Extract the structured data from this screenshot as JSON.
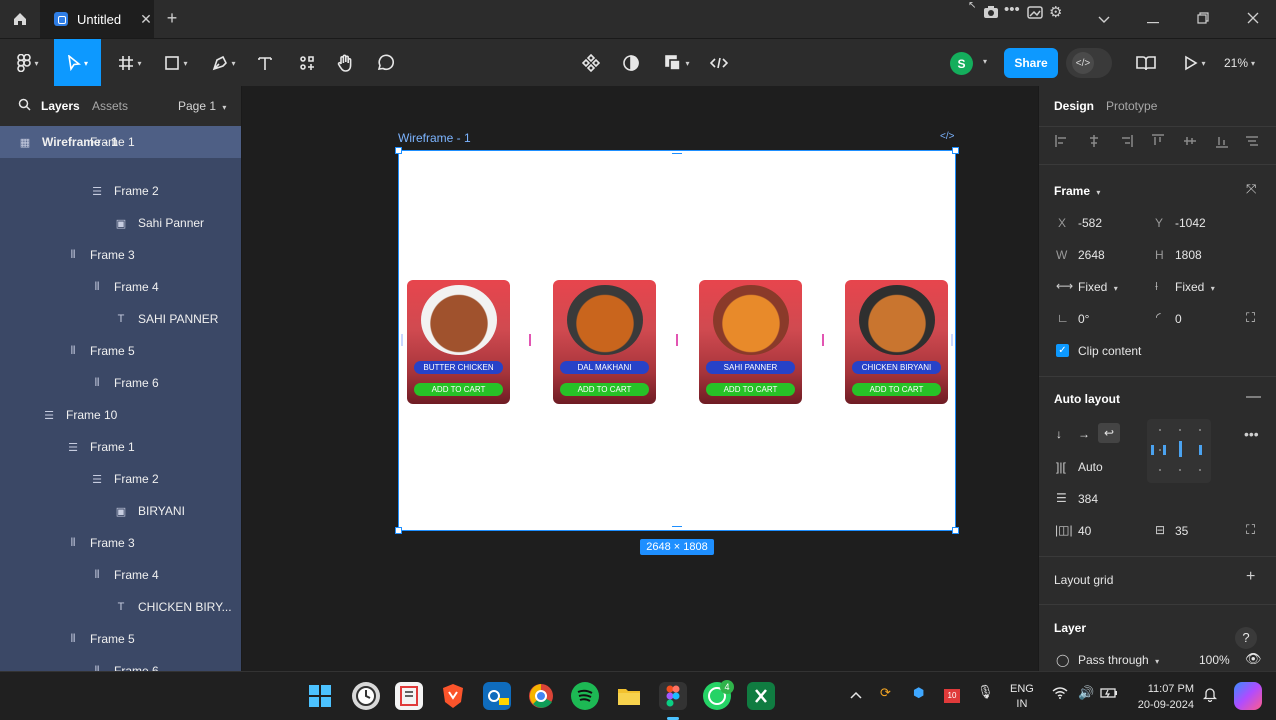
{
  "titlebar": {
    "file_tab": "Untitled",
    "new_tab": "+"
  },
  "toolbar": {
    "avatar_initial": "S",
    "share": "Share",
    "zoom": "21%"
  },
  "left_panel": {
    "tabs": [
      "Layers",
      "Assets"
    ],
    "page": "Page 1",
    "layers": [
      {
        "label": "Wireframe - 1",
        "indent": 0,
        "icon": "grid",
        "top": true
      },
      {
        "label": "Frame 1",
        "indent": 2,
        "icon": "rows"
      },
      {
        "label": "Frame 2",
        "indent": 3,
        "icon": "rows"
      },
      {
        "label": "Sahi Panner",
        "indent": 4,
        "icon": "image"
      },
      {
        "label": "Frame 3",
        "indent": 2,
        "icon": "cols"
      },
      {
        "label": "Frame 4",
        "indent": 3,
        "icon": "cols"
      },
      {
        "label": "SAHI PANNER",
        "indent": 4,
        "icon": "text"
      },
      {
        "label": "Frame 5",
        "indent": 2,
        "icon": "cols"
      },
      {
        "label": "Frame 6",
        "indent": 3,
        "icon": "cols"
      },
      {
        "label": "Frame 10",
        "indent": 1,
        "icon": "rows"
      },
      {
        "label": "Frame 1",
        "indent": 2,
        "icon": "rows"
      },
      {
        "label": "Frame 2",
        "indent": 3,
        "icon": "rows"
      },
      {
        "label": "BIRYANI",
        "indent": 4,
        "icon": "image"
      },
      {
        "label": "Frame 3",
        "indent": 2,
        "icon": "cols"
      },
      {
        "label": "Frame 4",
        "indent": 3,
        "icon": "cols"
      },
      {
        "label": "CHICKEN BIRY...",
        "indent": 4,
        "icon": "text"
      },
      {
        "label": "Frame 5",
        "indent": 2,
        "icon": "cols"
      },
      {
        "label": "Frame 6",
        "indent": 3,
        "icon": "cols"
      }
    ]
  },
  "canvas": {
    "frame_label": "Wireframe - 1",
    "frame_code": "</>",
    "size_badge": "2648 × 1808",
    "cards": [
      {
        "name": "BUTTER CHICKEN",
        "cart": "ADD TO CART",
        "food_color": "#a0522d",
        "plate_color": "#f2f2f2"
      },
      {
        "name": "DAL MAKHANI",
        "cart": "ADD TO CART",
        "food_color": "#c9651d",
        "plate_color": "#3a3a3a"
      },
      {
        "name": "SAHI PANNER",
        "cart": "ADD TO CART",
        "food_color": "#e88a2a",
        "plate_color": "#8a3a2a"
      },
      {
        "name": "CHICKEN BIRYANI",
        "cart": "ADD TO CART",
        "food_color": "#c9752f",
        "plate_color": "#2f2f2f"
      }
    ]
  },
  "right_panel": {
    "tabs": [
      "Design",
      "Prototype"
    ],
    "frame_title": "Frame",
    "x_label": "X",
    "x_value": "-582",
    "y_label": "Y",
    "y_value": "-1042",
    "w_label": "W",
    "w_value": "2648",
    "h_label": "H",
    "h_value": "1808",
    "w_sizing": "Fixed",
    "h_sizing": "Fixed",
    "rotation": "0°",
    "radius": "0",
    "clip_content": "Clip content",
    "auto_layout_title": "Auto layout",
    "spacing_mode": "Auto",
    "gap": "384",
    "padding_h": "40",
    "padding_v": "35",
    "layout_grid_title": "Layout grid",
    "layer_title": "Layer",
    "blend": "Pass through",
    "opacity": "100%",
    "help": "?"
  },
  "taskbar": {
    "lang_top": "ENG",
    "lang_bottom": "IN",
    "time": "11:07 PM",
    "date": "20-09-2024",
    "whatsapp_badge": "4",
    "calendar_day": "10"
  }
}
